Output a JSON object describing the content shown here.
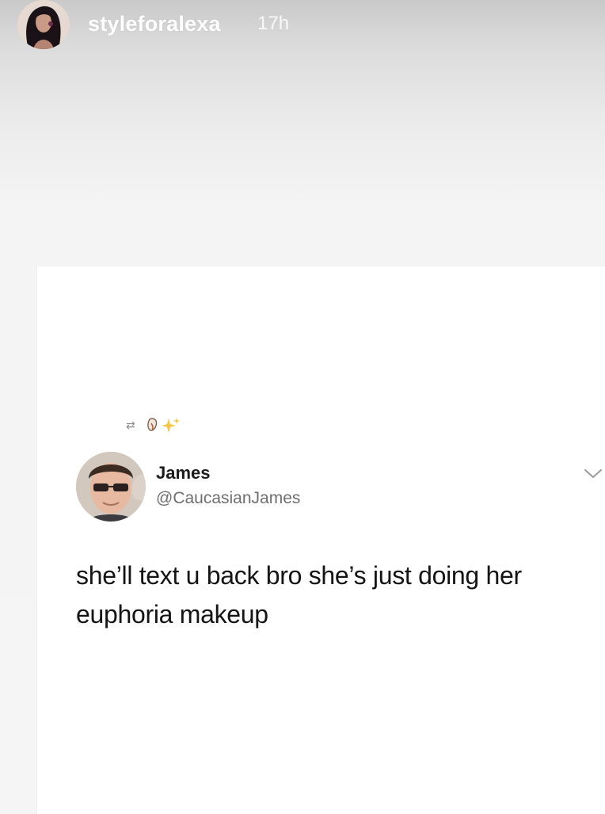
{
  "story": {
    "username": "styleforalexa",
    "time_ago": "17h",
    "avatar_icon": "profile-photo"
  },
  "tweet": {
    "social_context_icons": [
      "retweet-icon",
      "sparkles-emoji-icon"
    ],
    "retweet_glyph": "⇄",
    "author_name": "James",
    "author_handle": "@CaucasianJames",
    "text": "she’ll text u back bro she’s just doing her euphoria makeup",
    "menu_icon": "chevron-down-icon"
  },
  "colors": {
    "card_background": "#ffffff",
    "name_text": "#1b1b1b",
    "handle_text": "#6f6f6f",
    "story_header_text": "#ffffff"
  }
}
